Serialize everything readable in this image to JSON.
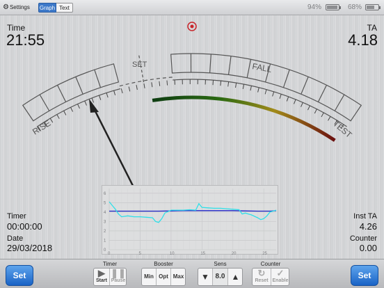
{
  "top_bar": {
    "settings_label": "Settings",
    "graph_tab_label": "Graph",
    "text_tab_label": "Text",
    "battery_1_text": "94%",
    "battery_1_level": 0.94,
    "battery_2_text": "68%",
    "battery_2_level": 0.68
  },
  "readouts": {
    "time_label": "Time",
    "time_value": "21:55",
    "ta_label": "TA",
    "ta_value": "4.18",
    "timer_label": "Timer",
    "timer_value": "00:00:00",
    "date_label": "Date",
    "date_value": "29/03/2018",
    "inst_ta_label": "Inst TA",
    "inst_ta_value": "4.26",
    "counter_label": "Counter",
    "counter_value": "0.00"
  },
  "dial": {
    "rise_label": "RISE",
    "set_label": "SET",
    "fall_label": "FALL",
    "test_label": "TEST"
  },
  "chart_data": {
    "type": "line",
    "x_ticks": [
      "0",
      "5",
      "10",
      "15",
      "20",
      "25"
    ],
    "y_ticks": [
      "0",
      "1",
      "2",
      "3",
      "4",
      "5",
      "6"
    ],
    "xlim": [
      0,
      27
    ],
    "ylim": [
      0,
      6.5
    ],
    "grid": true,
    "series": [
      {
        "color": "#1f24c8",
        "x": [
          0,
          2,
          5,
          8,
          10,
          12,
          15,
          18,
          20,
          22,
          24,
          26,
          27
        ],
        "values": [
          4.1,
          4.1,
          4.1,
          4.1,
          4.12,
          4.15,
          4.15,
          4.15,
          4.15,
          4.12,
          4.1,
          4.1,
          4.15
        ]
      },
      {
        "color": "#2fe0e8",
        "x": [
          0,
          0.5,
          1,
          1.5,
          2,
          3,
          4,
          5,
          6,
          7,
          7.5,
          8,
          8.5,
          9,
          10,
          11,
          12,
          13,
          14,
          14.5,
          15,
          16,
          17,
          18,
          19,
          20,
          21,
          21.5,
          22,
          22.5,
          23,
          24,
          24.5,
          25,
          25.5,
          26,
          27
        ],
        "values": [
          5.1,
          4.7,
          4.3,
          3.8,
          3.5,
          3.6,
          3.5,
          3.5,
          3.45,
          3.4,
          3.0,
          2.9,
          3.3,
          3.9,
          4.2,
          4.2,
          4.2,
          4.25,
          4.2,
          4.9,
          4.5,
          4.45,
          4.4,
          4.4,
          4.35,
          4.3,
          4.25,
          3.8,
          3.9,
          3.8,
          3.7,
          3.4,
          3.2,
          3.3,
          3.6,
          4.0,
          4.2
        ]
      }
    ]
  },
  "bottom_bar": {
    "set_left_label": "Set",
    "set_right_label": "Set",
    "timer": {
      "title": "Timer",
      "start_label": "Start",
      "pause_label": "Pause"
    },
    "booster": {
      "title": "Booster",
      "min_label": "Min",
      "opt_label": "Opt",
      "max_label": "Max"
    },
    "sens": {
      "title": "Sens",
      "value": "8.0"
    },
    "counter": {
      "title": "Counter",
      "reset_label": "Reset",
      "enable_label": "Enable"
    }
  }
}
